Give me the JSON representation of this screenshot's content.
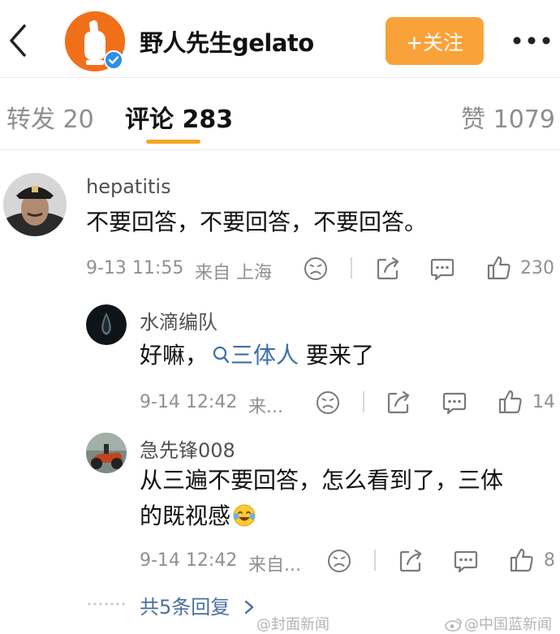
{
  "header": {
    "author_name": "野人先生gelato",
    "follow_label": "+关注"
  },
  "tabs": {
    "repost": "转发 20",
    "comment": "评论 283",
    "like": "赞 1079"
  },
  "comments": [
    {
      "username": "hepatitis",
      "text": "不要回答，不要回答，不要回答。",
      "time": "9-13 11:55",
      "location": "来自 上海",
      "likes": "230"
    }
  ],
  "replies": [
    {
      "username": "水滴编队",
      "text_prefix": "好嘛，",
      "topic": "三体人",
      "text_suffix": " 要来了",
      "time": "9-14 12:42",
      "location": "来...",
      "likes": "14"
    },
    {
      "username": "急先锋008",
      "text_line1": "从三遍不要回答，怎么看到了，三体",
      "text_line2": "的既视感",
      "time": "9-14 12:42",
      "location": "来自...",
      "likes": "8"
    }
  ],
  "show_replies_label": "共5条回复",
  "watermarks": {
    "left": "@封面新闻",
    "right": "@中国蓝新闻"
  },
  "colors": {
    "follow_button": "#f9a23a",
    "active_tab_underline": "#f5a623",
    "topic_link": "#3d6ea8",
    "reply_link": "#4a6ea0",
    "avatar_orange": "#f0701a"
  },
  "icons": [
    "back-arrow-icon",
    "verified-badge-icon",
    "more-icon",
    "dislike-face-icon",
    "share-icon",
    "comment-icon",
    "like-thumb-icon",
    "search-topic-icon",
    "chevron-right-icon",
    "laugh-cry-emoji-icon"
  ]
}
